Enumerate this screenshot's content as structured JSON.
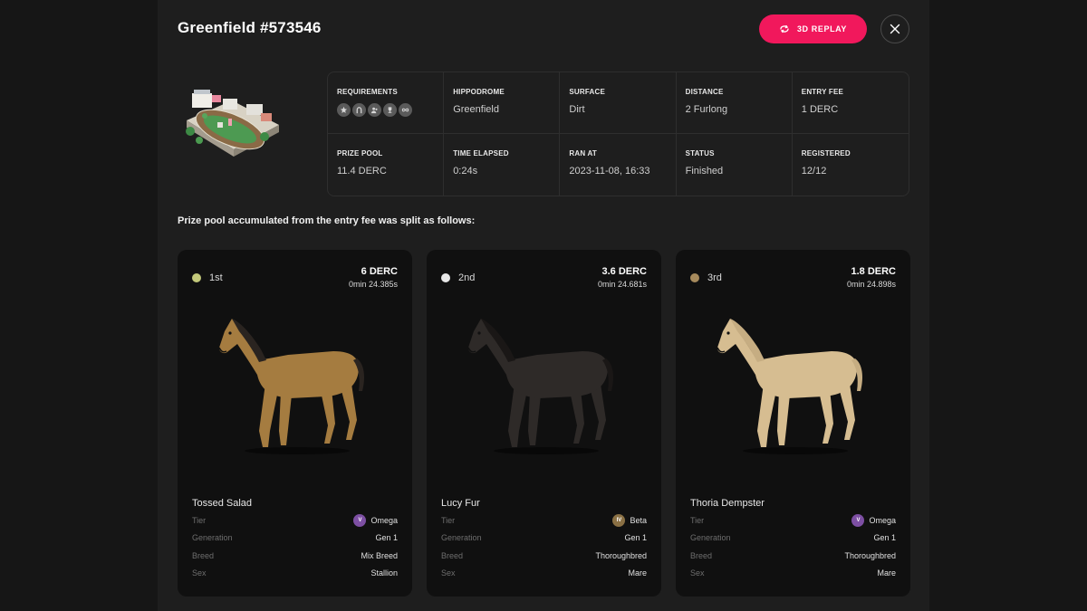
{
  "header": {
    "title": "Greenfield #573546",
    "replay_label": "3D REPLAY"
  },
  "race_info": {
    "requirements_label": "REQUIREMENTS",
    "requirement_icons": [
      "star-icon",
      "horseshoe-icon",
      "people-icon",
      "trophy-icon",
      "infinity-icon"
    ],
    "cells": [
      {
        "label": "HIPPODROME",
        "value": "Greenfield"
      },
      {
        "label": "SURFACE",
        "value": "Dirt"
      },
      {
        "label": "DISTANCE",
        "value": "2 Furlong"
      },
      {
        "label": "ENTRY FEE",
        "value": "1 DERC"
      },
      {
        "label": "PRIZE POOL",
        "value": "11.4 DERC"
      },
      {
        "label": "TIME ELAPSED",
        "value": "0:24s"
      },
      {
        "label": "RAN AT",
        "value": "2023-11-08, 16:33"
      },
      {
        "label": "STATUS",
        "value": "Finished"
      },
      {
        "label": "REGISTERED",
        "value": "12/12"
      }
    ]
  },
  "split_text": "Prize pool accumulated from the entry fee was split as follows:",
  "attr_labels": {
    "tier": "Tier",
    "generation": "Generation",
    "breed": "Breed",
    "sex": "Sex"
  },
  "winners": [
    {
      "place": "1st",
      "dot_color": "#c3c87a",
      "prize": "6 DERC",
      "time": "0min 24.385s",
      "name": "Tossed Salad",
      "tier": "Omega",
      "tier_symbol": "V",
      "tier_color": "#7d4fa3",
      "generation": "Gen 1",
      "breed": "Mix Breed",
      "sex": "Stallion",
      "coat": "#a57c40",
      "mane": "#2a2420"
    },
    {
      "place": "2nd",
      "dot_color": "#e8e8e8",
      "prize": "3.6 DERC",
      "time": "0min 24.681s",
      "name": "Lucy Fur",
      "tier": "Beta",
      "tier_symbol": "IV",
      "tier_color": "#8a7044",
      "generation": "Gen 1",
      "breed": "Thoroughbred",
      "sex": "Mare",
      "coat": "#2e2a28",
      "mane": "#1a1716"
    },
    {
      "place": "3rd",
      "dot_color": "#a68a5c",
      "prize": "1.8 DERC",
      "time": "0min 24.898s",
      "name": "Thoria Dempster",
      "tier": "Omega",
      "tier_symbol": "V",
      "tier_color": "#7d4fa3",
      "generation": "Gen 1",
      "breed": "Thoroughbred",
      "sex": "Mare",
      "coat": "#d6bd91",
      "mane": "#c6ad82"
    }
  ]
}
